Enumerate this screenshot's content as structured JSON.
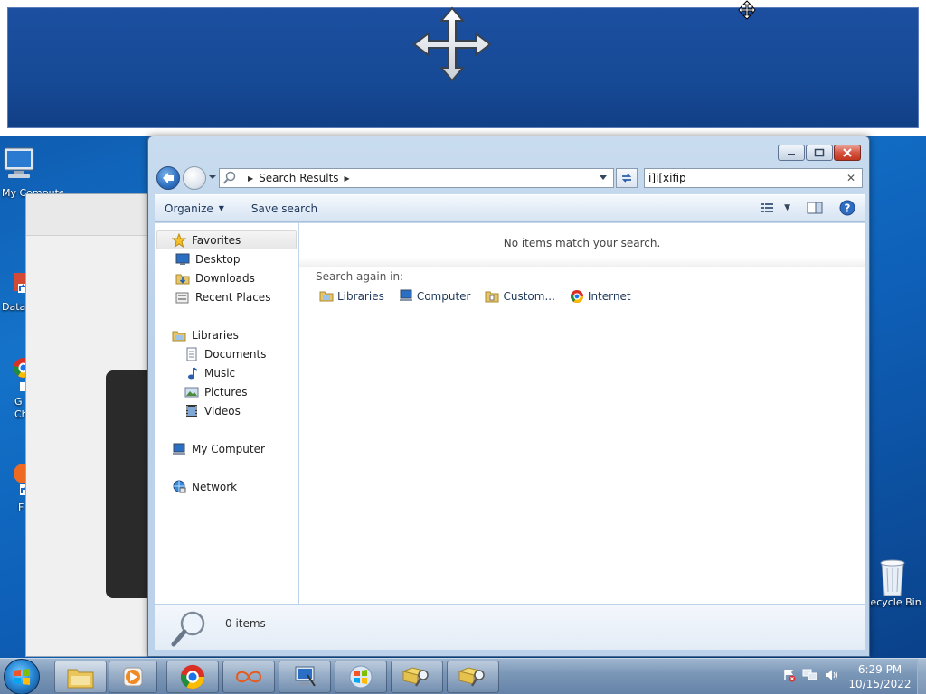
{
  "desktop": {
    "icons": [
      {
        "label": "My Computer",
        "icon": "computer-icon"
      },
      {
        "label": "Data",
        "icon": "shortcut-icon"
      },
      {
        "label": "G\nCh",
        "icon": "chrome-shortcut-icon"
      },
      {
        "label": "F",
        "icon": "shortcut-icon"
      },
      {
        "label": "Recycle Bin",
        "icon": "recycle-bin-icon"
      }
    ]
  },
  "explorer": {
    "address": {
      "crumb": "Search Results"
    },
    "search": {
      "value": "i]i[xifip"
    },
    "toolbar": {
      "organize": "Organize",
      "save_search": "Save search"
    },
    "nav": {
      "favorites": "Favorites",
      "desktop": "Desktop",
      "downloads": "Downloads",
      "recent": "Recent Places",
      "libraries": "Libraries",
      "documents": "Documents",
      "music": "Music",
      "pictures": "Pictures",
      "videos": "Videos",
      "my_computer": "My Computer",
      "network": "Network"
    },
    "content": {
      "no_items": "No items match your search.",
      "search_again": "Search again in:",
      "links": [
        "Libraries",
        "Computer",
        "Custom...",
        "Internet"
      ]
    },
    "details": {
      "count": "0 items"
    }
  },
  "taskbar": {
    "time": "6:29 PM",
    "date": "10/15/2022",
    "buttons": [
      "explorer-icon",
      "media-player-icon",
      "chrome-icon",
      "loop-app-icon",
      "remote-desktop-icon",
      "windows-logo-icon",
      "search-folder-icon",
      "search-folder-icon"
    ]
  },
  "colors": {
    "overlay_blue": "#164a96",
    "desktop_blue": "#1473c9",
    "close_red": "#c2361f"
  }
}
